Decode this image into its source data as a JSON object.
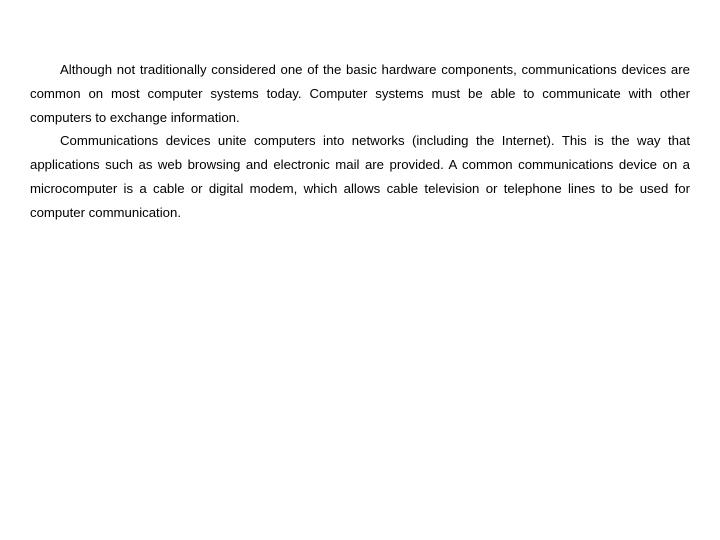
{
  "slide": {
    "background_color": "#ffffff",
    "text_color": "#000000",
    "paragraphs": [
      "Although not traditionally considered one of the basic hardware components, communications devices are common on most computer systems today. Computer systems must be able to communicate with other computers to exchange information.",
      "Communications devices unite computers into networks (including the Internet). This is the way that applications such as web browsing and electronic mail are provided. A common communications device on a microcomputer is a cable or digital modem, which allows cable television or telephone lines to be used for computer communication."
    ]
  }
}
